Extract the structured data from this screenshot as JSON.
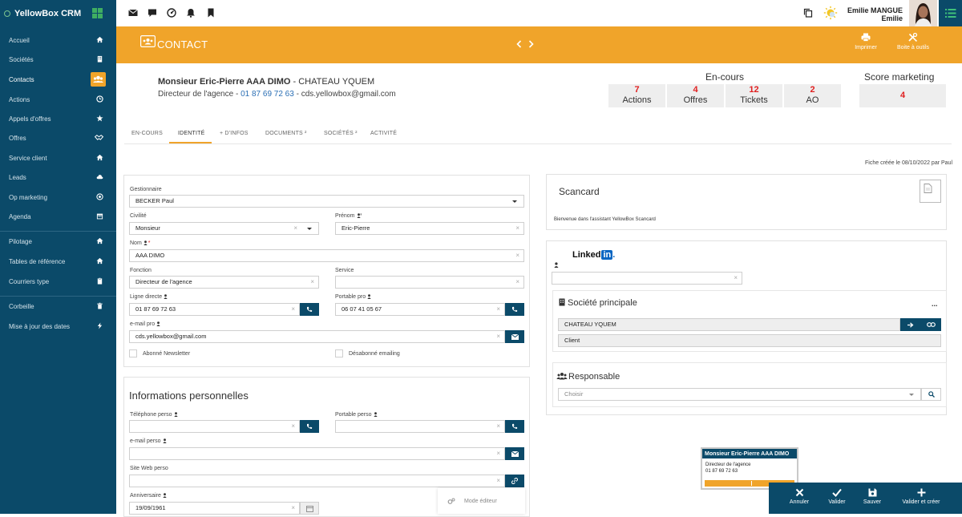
{
  "app": {
    "name": "YellowBox CRM"
  },
  "sidebar": {
    "items": [
      {
        "label": "Accueil",
        "icon": "home-icon"
      },
      {
        "label": "Sociétés",
        "icon": "building-icon"
      },
      {
        "label": "Contacts",
        "icon": "users-icon",
        "active": true
      },
      {
        "label": "Actions",
        "icon": "clock-icon"
      },
      {
        "label": "Appels d'offres",
        "icon": "star-icon"
      },
      {
        "label": "Offres",
        "icon": "handshake-icon"
      },
      {
        "label": "Service client",
        "icon": "home-icon"
      },
      {
        "label": "Leads",
        "icon": "cloud-icon"
      },
      {
        "label": "Op marketing",
        "icon": "target-icon"
      },
      {
        "label": "Agenda",
        "icon": "calendar-icon"
      },
      {
        "label": "Pilotage",
        "icon": "home-icon"
      },
      {
        "label": "Tables de référence",
        "icon": "home-icon"
      },
      {
        "label": "Courriers type",
        "icon": "clipboard-icon"
      },
      {
        "label": "Corbeille",
        "icon": "trash-icon"
      },
      {
        "label": "Mise à jour des dates",
        "icon": "bolt-icon"
      }
    ]
  },
  "topbar": {
    "user_name": "Emilie MANGUE",
    "user_first": "Emilie"
  },
  "header": {
    "title": "CONTACT",
    "print_label": "Imprimer",
    "tools_label": "Boite à outils"
  },
  "contact": {
    "name_bold": "Monsieur Eric-Pierre AAA DIMO",
    "company_suffix": " - CHATEAU YQUEM",
    "role": "Directeur de l'agence - ",
    "phone": "01 87 69 72 63",
    "email_suffix": " - cds.yellowbox@gmail.com"
  },
  "en_cours": {
    "title": "En-cours",
    "stats": [
      {
        "value": "7",
        "label": "Actions"
      },
      {
        "value": "4",
        "label": "Offres"
      },
      {
        "value": "12",
        "label": "Tickets"
      },
      {
        "value": "2",
        "label": "AO"
      }
    ]
  },
  "score": {
    "title": "Score marketing",
    "value": "4"
  },
  "tabs": [
    {
      "label": "EN-COURS"
    },
    {
      "label": "IDENTITÉ",
      "active": true
    },
    {
      "label": "+ D'INFOS"
    },
    {
      "label": "DOCUMENTS ²"
    },
    {
      "label": "SOCIÉTÉS ²"
    },
    {
      "label": "ACTIVITÉ"
    }
  ],
  "fiche_note": "Fiche créée le 08/10/2022 par Paul",
  "identite": {
    "gestionnaire_label": "Gestionnaire",
    "gestionnaire_value": "BECKER Paul",
    "civilite_label": "Civilité",
    "civilite_value": "Monsieur",
    "prenom_label": "Prénom",
    "prenom_value": "Eric-Pierre",
    "nom_label": "Nom",
    "nom_value": "AAA DIMO",
    "fonction_label": "Fonction",
    "fonction_value": "Directeur de l'agence",
    "service_label": "Service",
    "service_value": "",
    "ligne_label": "Ligne directe",
    "ligne_value": "01 87 69 72 63",
    "portable_label": "Portable pro",
    "portable_value": "06 07 41 05 67",
    "email_label": "e-mail pro",
    "email_value": "cds.yellowbox@gmail.com",
    "newsletter_label": "Abonné Newsletter",
    "desabonne_label": "Désabonné emailing"
  },
  "perso": {
    "title": "Informations personnelles",
    "tel_label": "Téléphone perso",
    "portable_label": "Portable perso",
    "email_label": "e-mail perso",
    "site_label": "Site Web perso",
    "anniv_label": "Anniversaire",
    "anniv_value": "19/09/1961"
  },
  "mode_editeur": "Mode éditeur",
  "scancard": {
    "title": "Scancard",
    "welcome": "Bienvenue dans l'assistant YellowBox Scancard"
  },
  "linkedin": {
    "logo_text": "Linked",
    "logo_in": "in"
  },
  "societe": {
    "title": "Société principale",
    "more": "...",
    "name": "CHATEAU YQUEM",
    "type": "Client"
  },
  "responsable": {
    "title": "Responsable",
    "placeholder": "Choisir"
  },
  "mini_card": {
    "name": "Monsieur Eric-Pierre AAA DIMO",
    "role": "Directeur de l'agence",
    "phone": "01 87 69 72 63"
  },
  "actions": {
    "annuler": "Annuler",
    "valider": "Valider",
    "sauver": "Sauver",
    "valider_creer": "Valider et créer"
  },
  "colors": {
    "navy": "#0b4a69",
    "orange": "#f0a42a",
    "red": "#e02020",
    "link": "#2b6fb5"
  }
}
